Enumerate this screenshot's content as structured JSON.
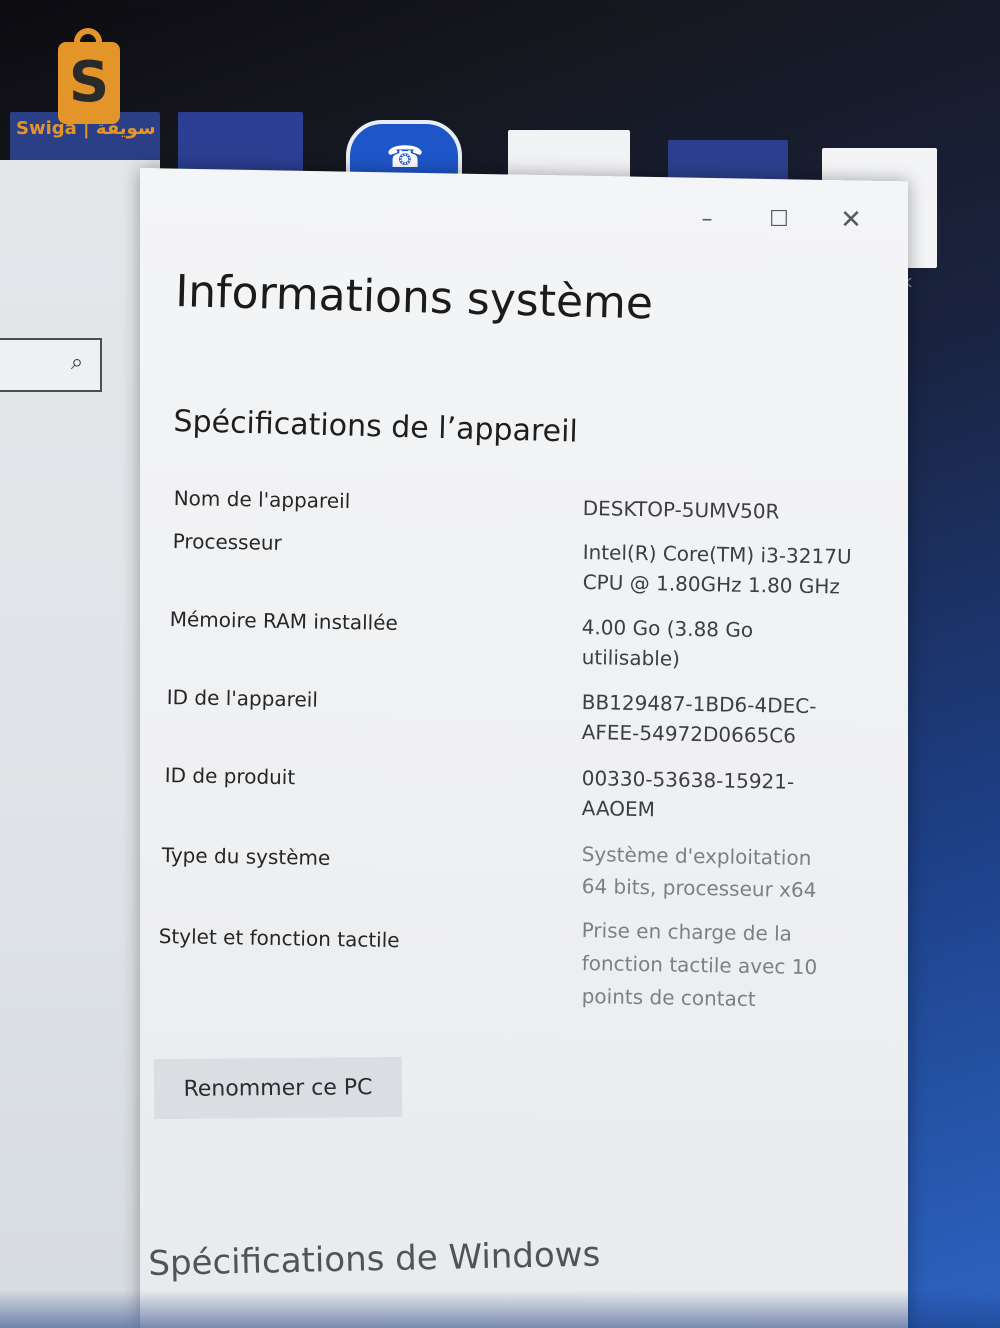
{
  "watermark": {
    "logo_text": "Swiga | سويقة"
  },
  "desktop": {
    "partial_label": "ok"
  },
  "window": {
    "title": "Informations système",
    "controls": {
      "minimize": "–",
      "maximize": "☐",
      "close": "✕"
    }
  },
  "device_specs": {
    "heading": "Spécifications de l’appareil",
    "rows": [
      {
        "label": "Nom de l'appareil",
        "value": "DESKTOP-5UMV50R"
      },
      {
        "label": "Processeur",
        "value": "Intel(R) Core(TM) i3-3217U",
        "value2": "CPU @ 1.80GHz   1.80 GHz"
      },
      {
        "label": "Mémoire RAM installée",
        "value": "4.00 Go (3.88 Go",
        "value2": "utilisable)"
      },
      {
        "label": "ID de l'appareil",
        "value": "BB129487-1BD6-4DEC-",
        "value2": "AFEE-54972D0665C6"
      },
      {
        "label": "ID de produit",
        "value": "00330-53638-15921-",
        "value2": "AAOEM"
      },
      {
        "label": "Type du système",
        "value": "Système d'exploitation",
        "value2": "64 bits, processeur x64"
      },
      {
        "label": "Stylet et fonction tactile",
        "value": "Prise en charge de la",
        "value2": "fonction tactile avec 10",
        "value3": "points de contact"
      }
    ],
    "rename_button": "Renommer ce PC"
  },
  "windows_specs": {
    "heading": "Spécifications de Windows"
  },
  "icons": {
    "search": "search-icon",
    "minimize": "minimize-icon",
    "maximize": "maximize-icon",
    "close": "close-icon"
  }
}
